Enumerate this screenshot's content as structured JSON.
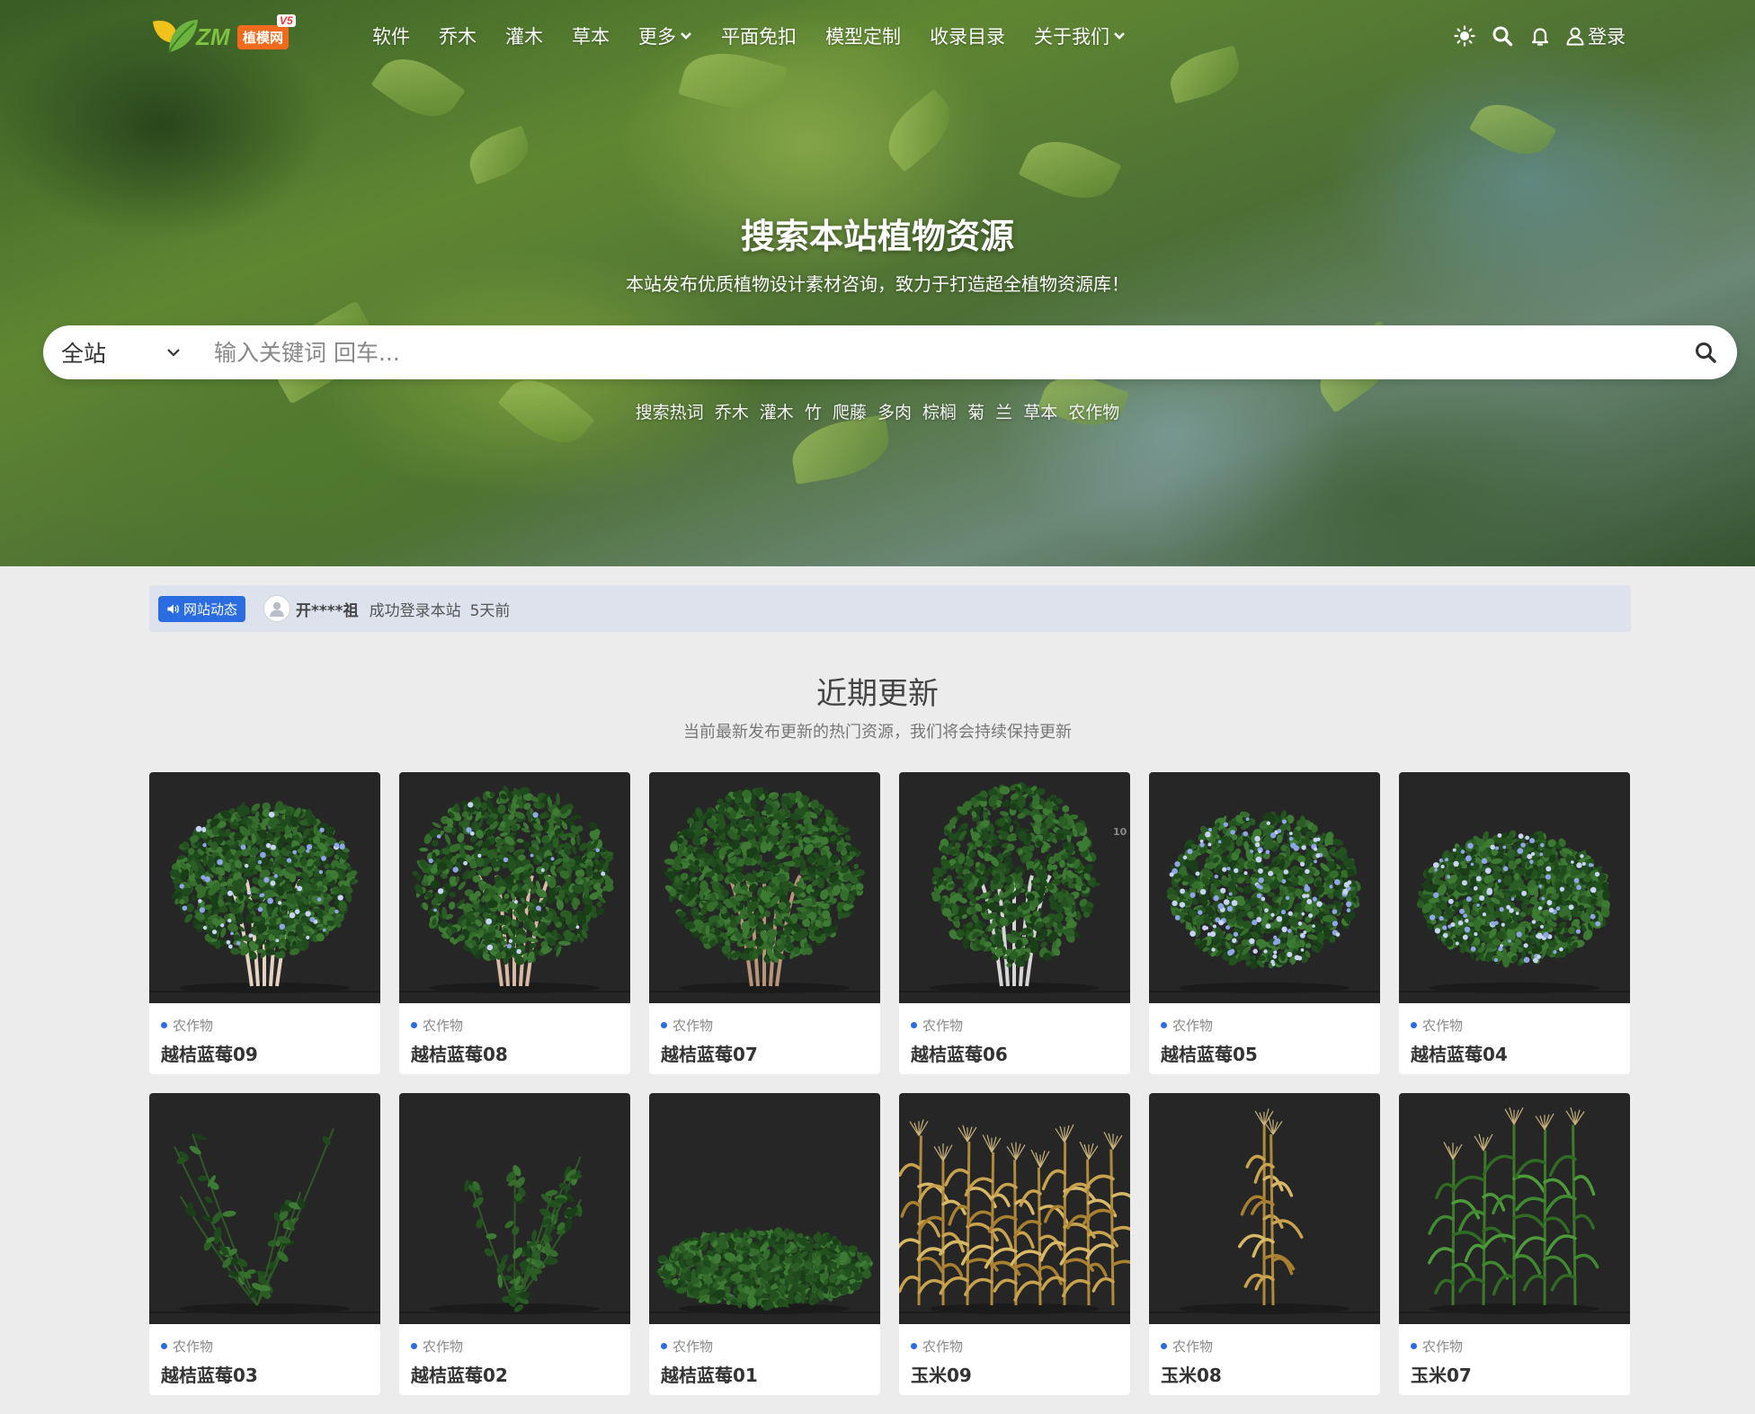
{
  "header": {
    "logo": {
      "text": "ZM",
      "badge": "植模网",
      "version": "V5"
    },
    "nav": [
      {
        "label": "软件",
        "dropdown": false
      },
      {
        "label": "乔木",
        "dropdown": false
      },
      {
        "label": "灌木",
        "dropdown": false
      },
      {
        "label": "草本",
        "dropdown": false
      },
      {
        "label": "更多",
        "dropdown": true
      },
      {
        "label": "平面免扣",
        "dropdown": false
      },
      {
        "label": "模型定制",
        "dropdown": false
      },
      {
        "label": "收录目录",
        "dropdown": false
      },
      {
        "label": "关于我们",
        "dropdown": true
      }
    ],
    "icons": [
      "sun-icon",
      "search-icon",
      "bell-icon"
    ],
    "login_label": "登录"
  },
  "hero": {
    "title": "搜索本站植物资源",
    "subtitle": "本站发布优质植物设计素材咨询，致力于打造超全植物资源库！",
    "search": {
      "scope": "全站",
      "placeholder": "输入关键词 回车..."
    },
    "hot_label": "搜索热词",
    "hot_words": [
      "乔木",
      "灌木",
      "竹",
      "爬藤",
      "多肉",
      "棕榈",
      "菊",
      "兰",
      "草本",
      "农作物"
    ]
  },
  "ticker": {
    "badge": "网站动态",
    "user": "开****祖",
    "message": "成功登录本站",
    "time": "5天前"
  },
  "section": {
    "title": "近期更新",
    "subtitle": "当前最新发布更新的热门资源，我们将会持续保持更新"
  },
  "items": [
    {
      "category": "农作物",
      "name": "越桔蓝莓09",
      "kind": "shrub-tall-berry"
    },
    {
      "category": "农作物",
      "name": "越桔蓝莓08",
      "kind": "shrub-open-berry"
    },
    {
      "category": "农作物",
      "name": "越桔蓝莓07",
      "kind": "shrub-dense"
    },
    {
      "category": "农作物",
      "name": "越桔蓝莓06",
      "kind": "shrub-upright",
      "overlay": "10"
    },
    {
      "category": "农作物",
      "name": "越桔蓝莓05",
      "kind": "shrub-berry-flower"
    },
    {
      "category": "农作物",
      "name": "越桔蓝莓04",
      "kind": "shrub-round-berry"
    },
    {
      "category": "农作物",
      "name": "越桔蓝莓03",
      "kind": "sprig-sparse"
    },
    {
      "category": "农作物",
      "name": "越桔蓝莓02",
      "kind": "sprig-bushy"
    },
    {
      "category": "农作物",
      "name": "越桔蓝莓01",
      "kind": "groundcover"
    },
    {
      "category": "农作物",
      "name": "玉米09",
      "kind": "corn-dry-field"
    },
    {
      "category": "农作物",
      "name": "玉米08",
      "kind": "corn-dry-single"
    },
    {
      "category": "农作物",
      "name": "玉米07",
      "kind": "corn-green-group"
    }
  ]
}
